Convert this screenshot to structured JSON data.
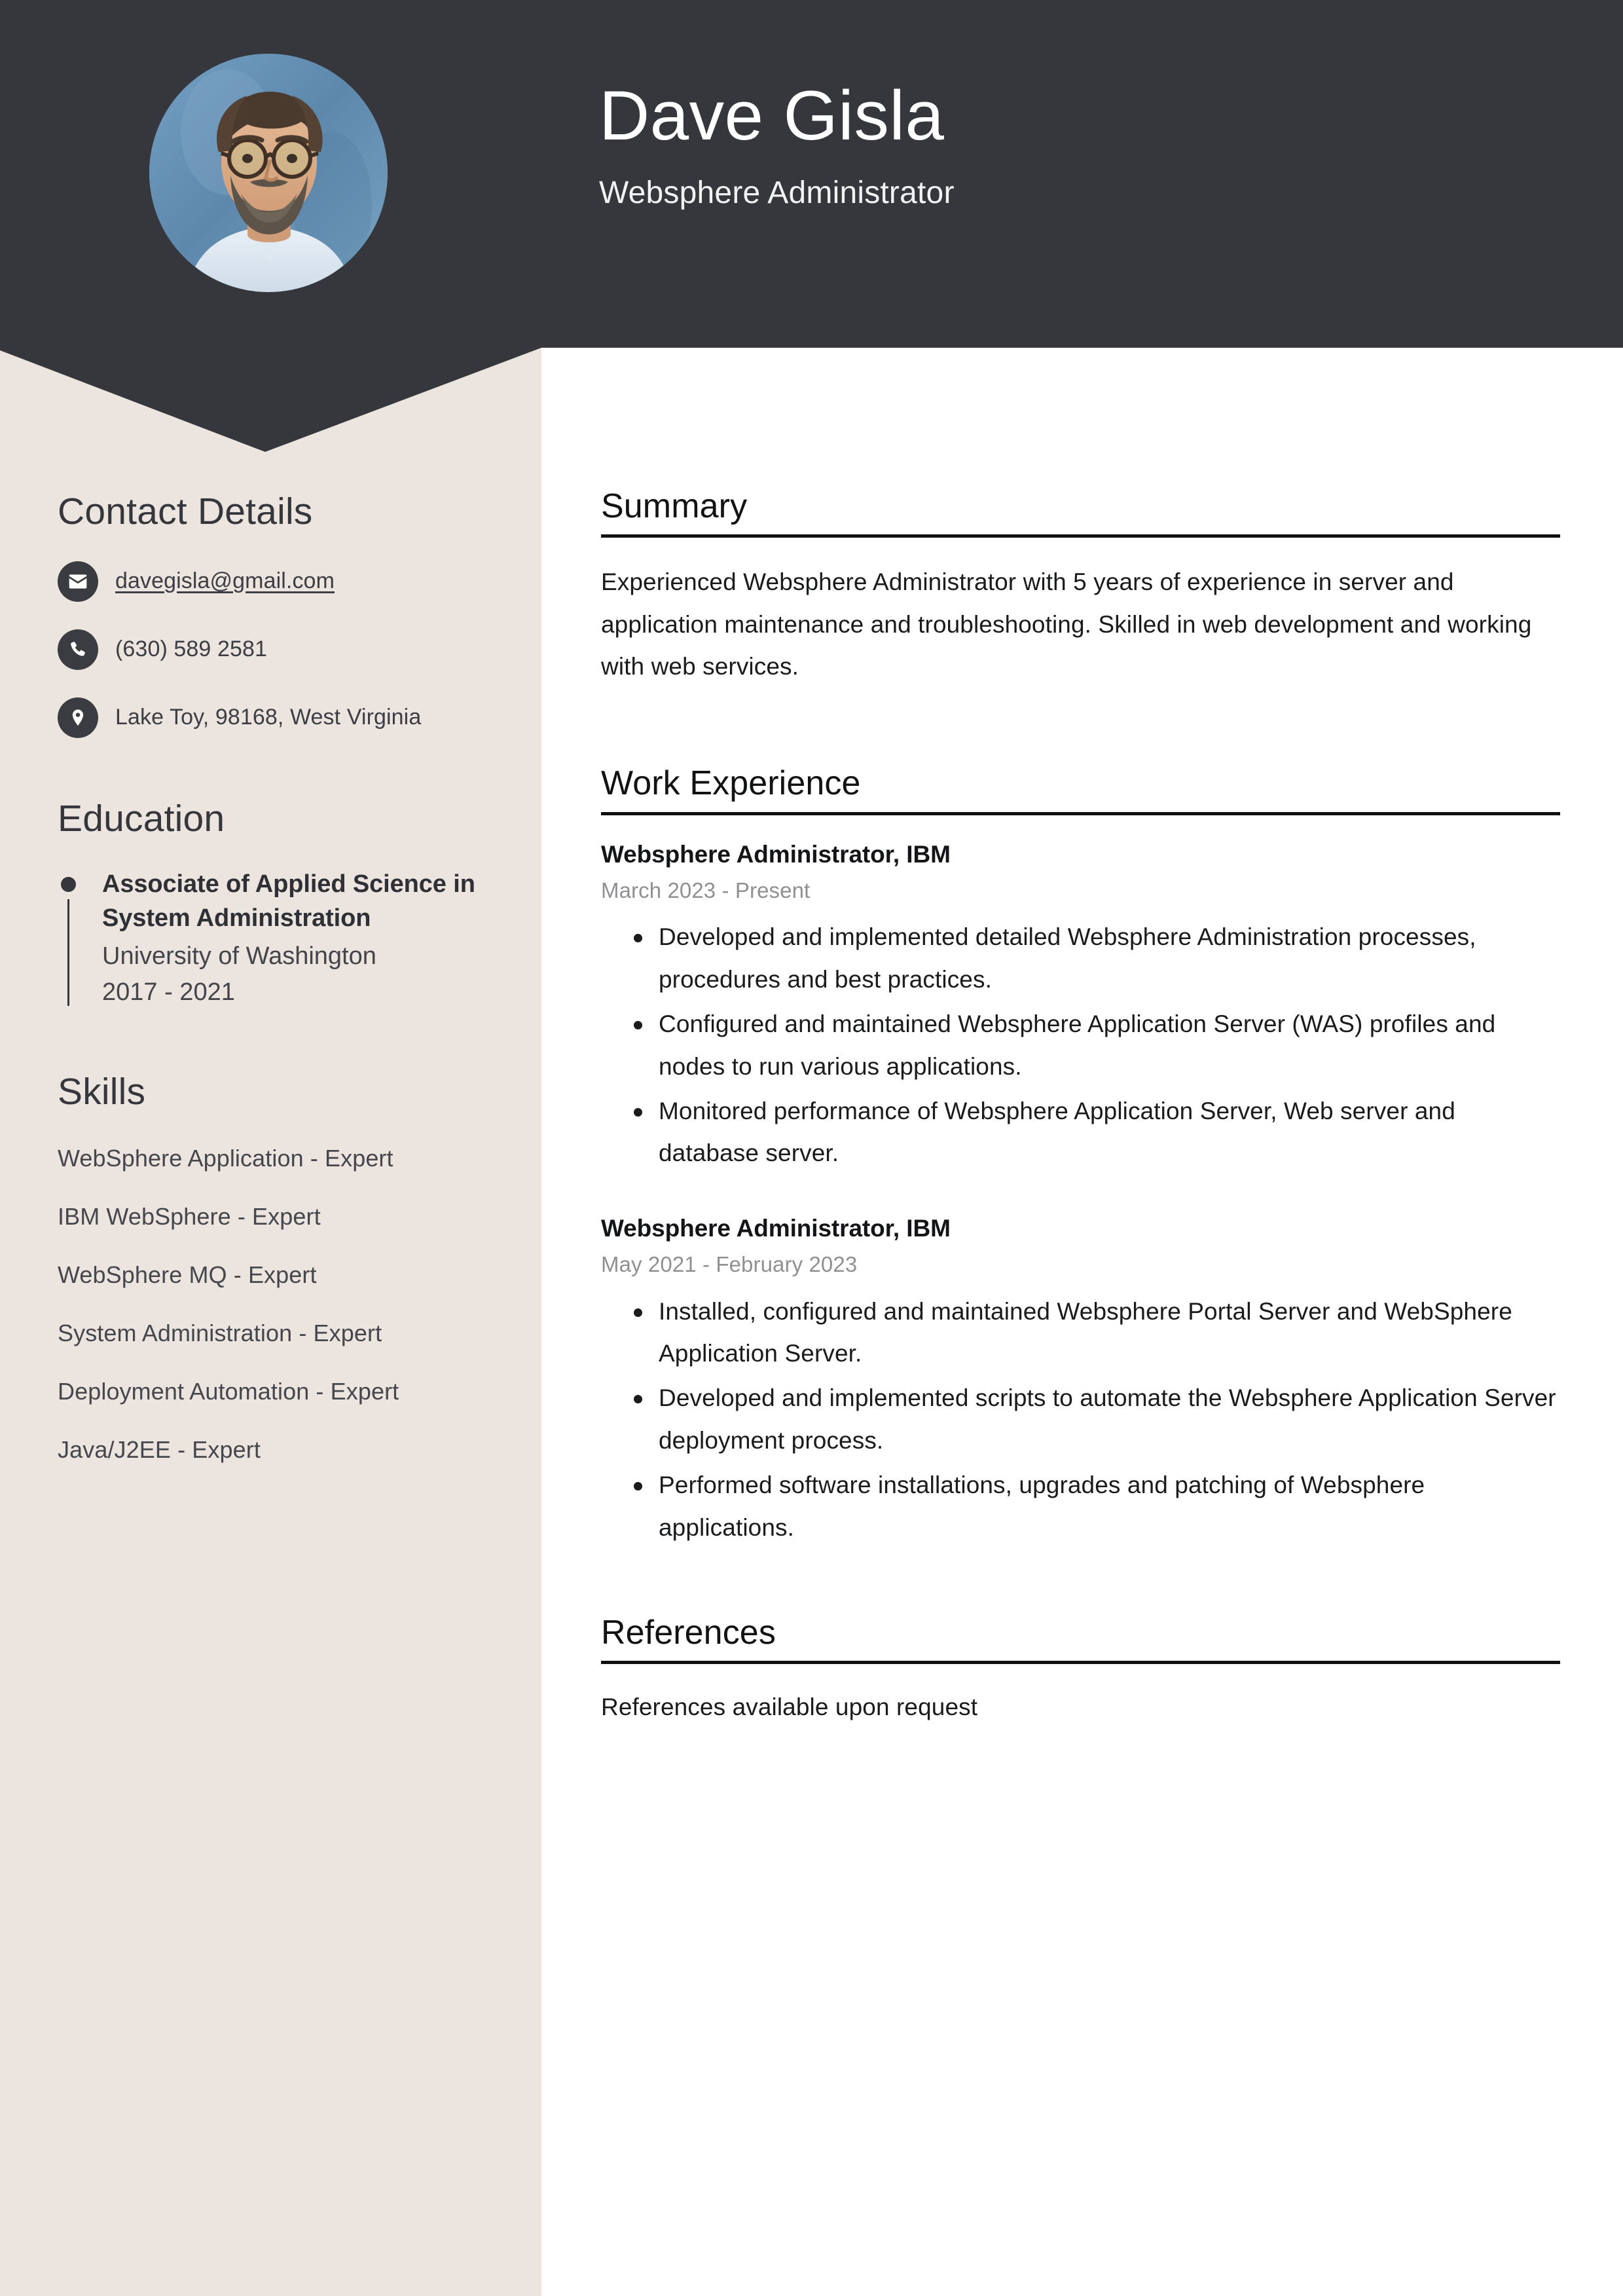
{
  "colors": {
    "header_bg": "#35373d",
    "sidebar_bg": "#ece4df",
    "page_bg": "#ffffff",
    "heading_text": "#111214",
    "muted_text": "#8e9094"
  },
  "header": {
    "name": "Dave Gisla",
    "job_title": "Websphere Administrator",
    "avatar_alt": "profile-photo"
  },
  "sidebar": {
    "contact": {
      "heading": "Contact Details",
      "items": [
        {
          "icon": "envelope-icon",
          "value": "davegisla@gmail.com",
          "is_link": true
        },
        {
          "icon": "phone-icon",
          "value": "(630) 589 2581",
          "is_link": false
        },
        {
          "icon": "location-pin-icon",
          "value": "Lake Toy, 98168, West Virginia",
          "is_link": false
        }
      ]
    },
    "education": {
      "heading": "Education",
      "items": [
        {
          "degree": "Associate of Applied Science in System Administration",
          "school": "University of Washington",
          "years": "2017 - 2021"
        }
      ]
    },
    "skills": {
      "heading": "Skills",
      "items": [
        "WebSphere Application - Expert",
        "IBM WebSphere - Expert",
        "WebSphere MQ - Expert",
        "System Administration - Expert",
        "Deployment Automation - Expert",
        "Java/J2EE - Expert"
      ]
    }
  },
  "main": {
    "summary": {
      "heading": "Summary",
      "text": "Experienced Websphere Administrator with 5 years of experience in server and application maintenance and troubleshooting. Skilled in web development and working with web services."
    },
    "work_experience": {
      "heading": "Work Experience",
      "jobs": [
        {
          "title": "Websphere Administrator, IBM",
          "dates": "March 2023 - Present",
          "bullets": [
            "Developed and implemented detailed Websphere Administration processes, procedures and best practices.",
            "Configured and maintained Websphere Application Server (WAS) profiles and nodes to run various applications.",
            "Monitored performance of Websphere Application Server, Web server and database server."
          ]
        },
        {
          "title": "Websphere Administrator, IBM",
          "dates": "May 2021 - February 2023",
          "bullets": [
            "Installed, configured and maintained Websphere Portal Server and WebSphere Application Server.",
            "Developed and implemented scripts to automate the Websphere Application Server deployment process.",
            "Performed software installations, upgrades and patching of Websphere applications."
          ]
        }
      ]
    },
    "references": {
      "heading": "References",
      "text": "References available upon request"
    }
  }
}
